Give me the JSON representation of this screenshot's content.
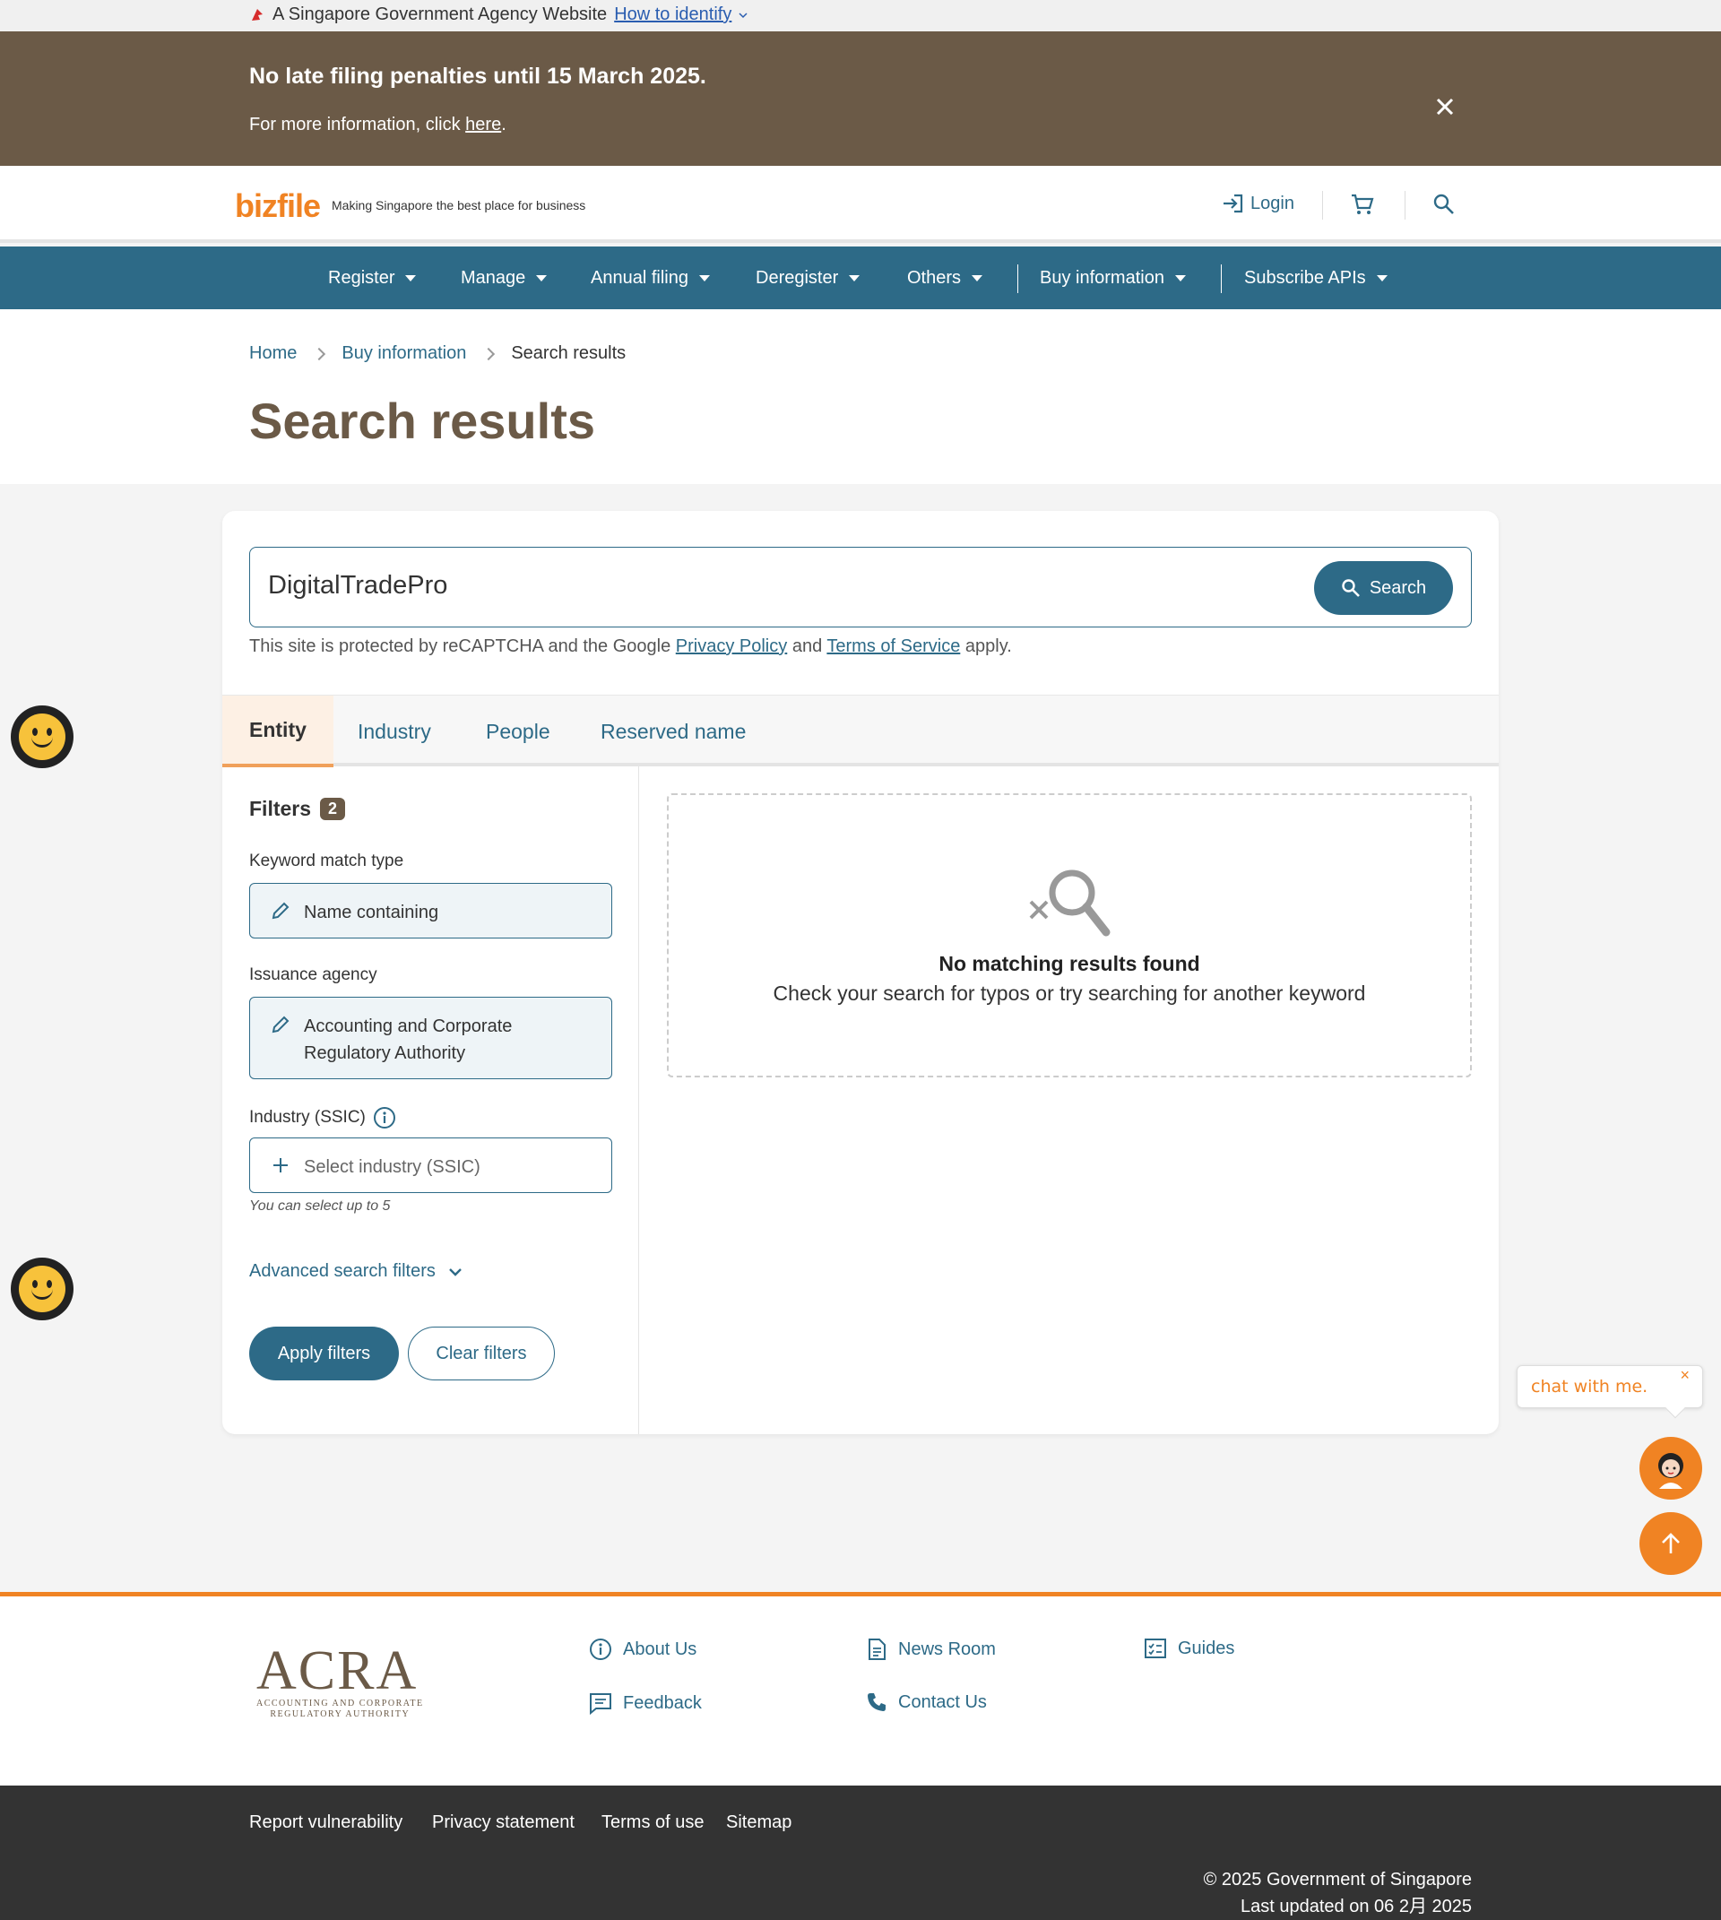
{
  "masthead": {
    "text": "A Singapore Government Agency Website",
    "link": "How to identify"
  },
  "banner": {
    "title": "No late filing penalties until 15 March 2025.",
    "prefix": "For more information, click ",
    "link": "here",
    "suffix": "."
  },
  "header": {
    "logo": "bizfile",
    "tagline": "Making Singapore the best place for business",
    "login": "Login"
  },
  "nav": [
    "Register",
    "Manage",
    "Annual filing",
    "Deregister",
    "Others",
    "Buy information",
    "Subscribe APIs"
  ],
  "breadcrumb": {
    "home": "Home",
    "parent": "Buy information",
    "current": "Search results"
  },
  "page_title": "Search results",
  "search": {
    "value": "DigitalTradePro",
    "button": "Search",
    "recaptcha_prefix": "This site is protected by reCAPTCHA and the Google ",
    "privacy": "Privacy Policy",
    "and": " and ",
    "terms": "Terms of Service",
    "apply": " apply."
  },
  "tabs": [
    "Entity",
    "Industry",
    "People",
    "Reserved name"
  ],
  "filters": {
    "title": "Filters",
    "count": "2",
    "keyword_label": "Keyword match type",
    "keyword_value": "Name containing",
    "agency_label": "Issuance agency",
    "agency_value_line1": "Accounting and Corporate",
    "agency_value_line2": "Regulatory Authority",
    "industry_label": "Industry (SSIC)",
    "industry_placeholder": "Select industry (SSIC)",
    "industry_hint": "You can select up to 5",
    "advanced": "Advanced search filters",
    "apply": "Apply filters",
    "clear": "Clear filters"
  },
  "results": {
    "title": "No matching results found",
    "message": "Check your search for typos or try searching for another keyword"
  },
  "chat": {
    "bubble": "chat with me.",
    "close": "×"
  },
  "footer": {
    "acra_logo": "ACRA",
    "acra_line1": "ACCOUNTING AND CORPORATE",
    "acra_line2": "REGULATORY AUTHORITY",
    "links": {
      "about": "About Us",
      "news": "News Room",
      "guides": "Guides",
      "feedback": "Feedback",
      "contact": "Contact Us"
    },
    "bottom_links": [
      "Report vulnerability",
      "Privacy statement",
      "Terms of use",
      "Sitemap"
    ],
    "copyright": "© 2025 Government of Singapore",
    "updated": "Last updated on 06 2月 2025"
  },
  "colors": {
    "primary": "#2d6a87",
    "brown": "#6b5a47",
    "orange": "#f08323",
    "footer_dark": "#333333"
  }
}
